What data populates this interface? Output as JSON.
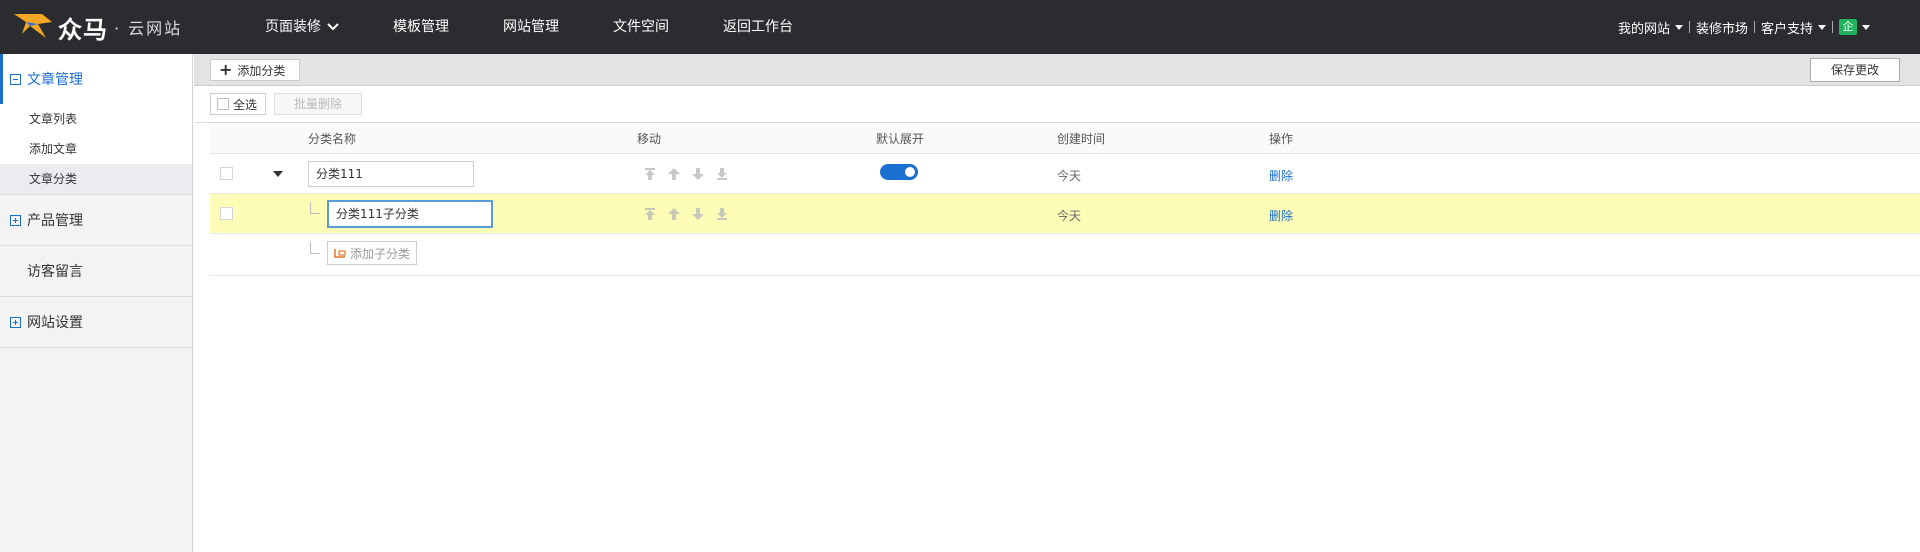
{
  "brand": {
    "logo_text": "众马",
    "logo_sub": "· 云网站"
  },
  "nav": {
    "items": [
      {
        "label": "页面装修",
        "has_dropdown": true
      },
      {
        "label": "模板管理"
      },
      {
        "label": "网站管理"
      },
      {
        "label": "文件空间"
      },
      {
        "label": "返回工作台"
      }
    ]
  },
  "header_right": {
    "my_site": "我的网站",
    "market": "装修市场",
    "support": "客户支持",
    "account_badge": "企"
  },
  "sidebar": {
    "groups": [
      {
        "label": "文章管理",
        "expanded": true,
        "items": [
          "文章列表",
          "添加文章",
          "文章分类"
        ],
        "active_item": "文章分类"
      },
      {
        "label": "产品管理",
        "expanded": false
      },
      {
        "label": "访客留言"
      },
      {
        "label": "网站设置",
        "expanded": false
      }
    ]
  },
  "toolbar": {
    "add_category": "添加分类",
    "save_changes": "保存更改"
  },
  "actions": {
    "select_all": "全选",
    "batch_delete": "批量删除"
  },
  "table": {
    "headers": {
      "name": "分类名称",
      "move": "移动",
      "default_expand": "默认展开",
      "created": "创建时间",
      "ops": "操作"
    },
    "rows": [
      {
        "name": "分类111",
        "created": "今天",
        "op": "删除",
        "default_expand": true
      },
      {
        "name": "分类111子分类",
        "created": "今天",
        "op": "删除"
      }
    ],
    "add_subcategory": "添加子分类"
  },
  "colors": {
    "accent": "#1a6fd1",
    "topbar": "#2b2c30",
    "highlight_row": "#fdfdb8",
    "logo_orange": "#f5a623"
  }
}
